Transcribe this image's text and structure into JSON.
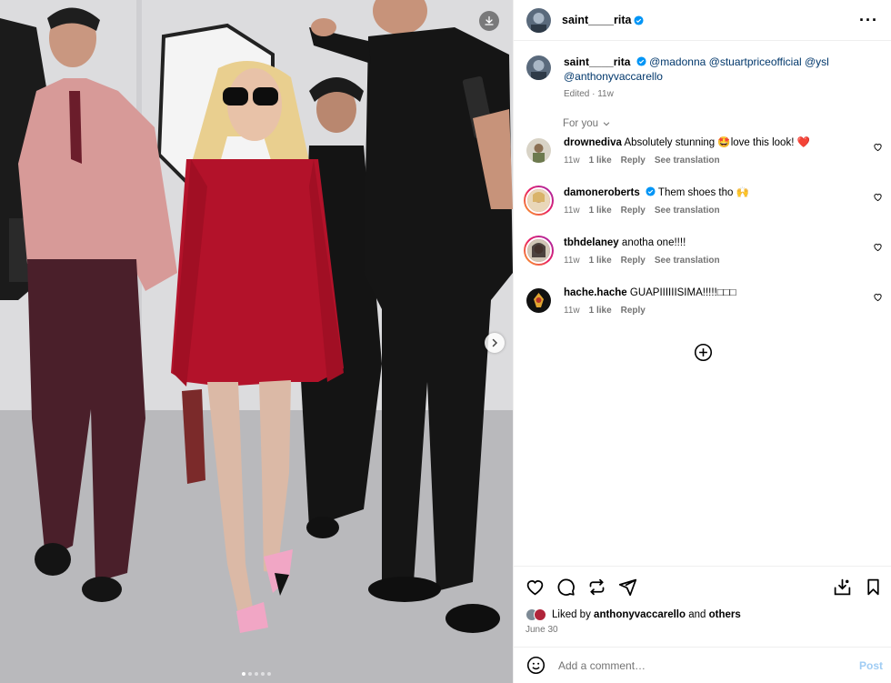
{
  "post": {
    "username": "saint____rita",
    "caption_mentions": [
      "@madonna",
      "@stuartpriceofficial",
      "@ysl",
      "@anthonyvaccarello"
    ],
    "edited": "Edited · 11w",
    "for_you": "For you",
    "carousel_count": 5,
    "carousel_active": 1
  },
  "comments": [
    {
      "user": "drownediva",
      "text": "Absolutely stunning 🤩love this look! ❤️",
      "time": "11w",
      "likes": "1 like",
      "reply": "Reply",
      "translate": "See translation",
      "verified": false
    },
    {
      "user": "damoneroberts",
      "text": "Them shoes tho 🙌",
      "time": "11w",
      "likes": "1 like",
      "reply": "Reply",
      "translate": "See translation",
      "verified": true
    },
    {
      "user": "tbhdelaney",
      "text": "anotha one!!!!",
      "time": "11w",
      "likes": "1 like",
      "reply": "Reply",
      "translate": "See translation",
      "verified": false
    },
    {
      "user": "hache.hache",
      "text": "GUAPIIIIIISIMA!!!!!□□□",
      "time": "11w",
      "likes": "1 like",
      "reply": "Reply",
      "translate": "",
      "verified": false
    }
  ],
  "likes": {
    "prefix": "Liked by",
    "user": "anthonyvaccarello",
    "and": "and",
    "others": "others"
  },
  "date": "June 30",
  "add_comment": {
    "placeholder": "Add a comment…",
    "post": "Post"
  },
  "colors": {
    "accent_link": "#00376b",
    "verified": "#0095f6",
    "post_disabled": "#9fccf4",
    "muted": "#737373",
    "dress": "#b3122a"
  }
}
